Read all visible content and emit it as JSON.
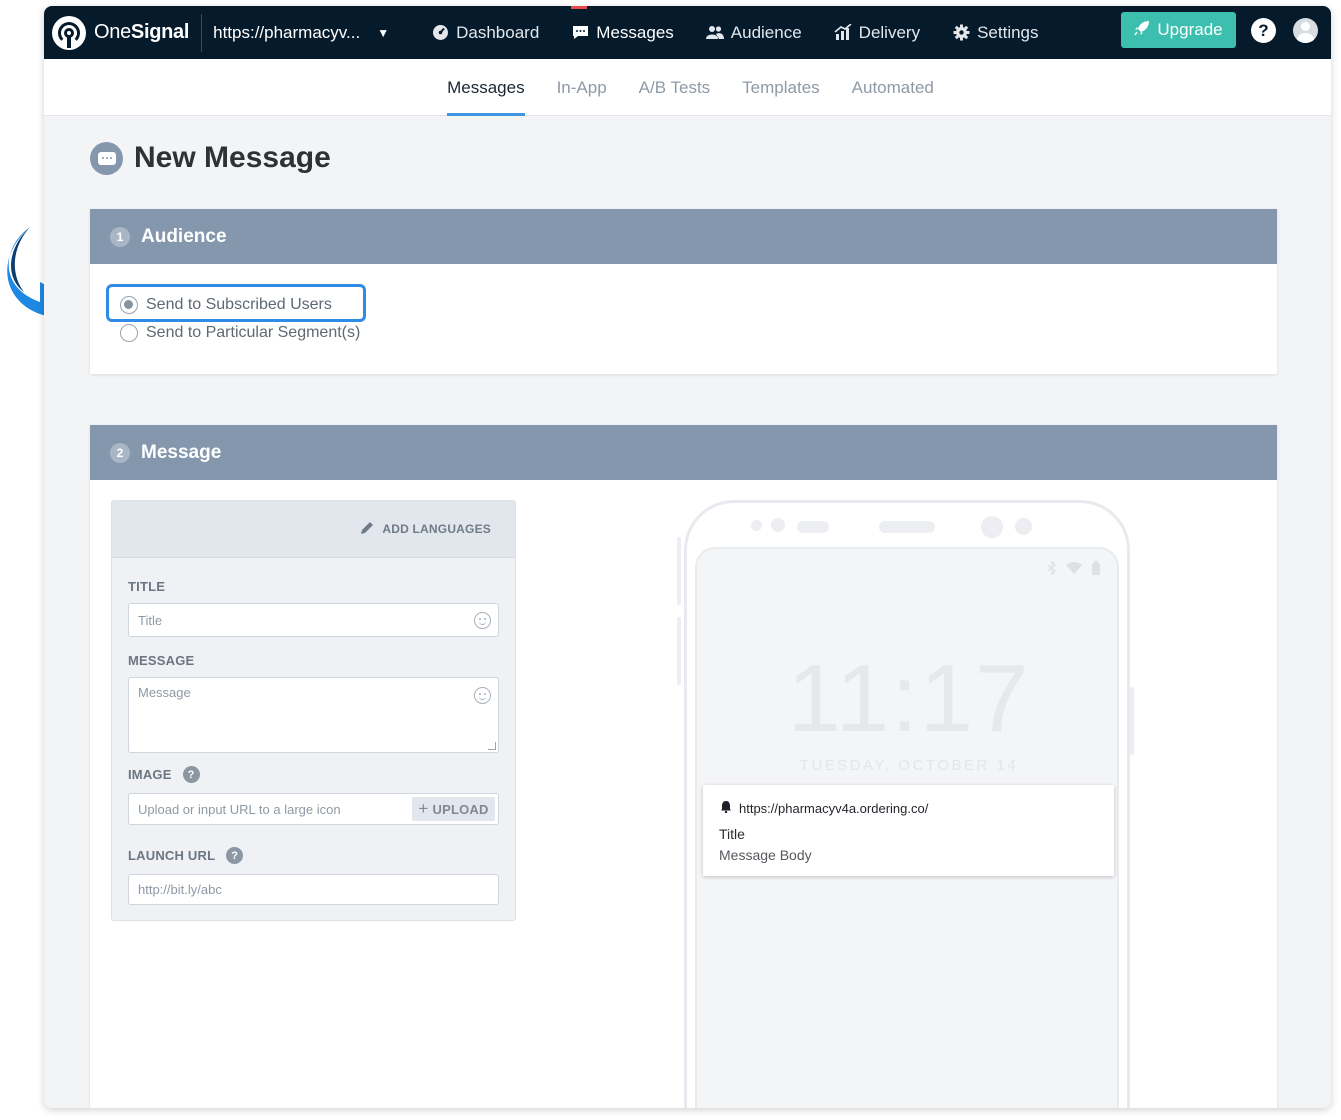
{
  "brand": {
    "name_part1": "One",
    "name_part2": "Signal"
  },
  "app_select": {
    "value": "https://pharmacyv...",
    "caret": "▼"
  },
  "topnav": {
    "items": [
      {
        "label": "Dashboard",
        "icon": "dashboard-icon"
      },
      {
        "label": "Messages",
        "icon": "messages-icon",
        "active": true
      },
      {
        "label": "Audience",
        "icon": "audience-icon"
      },
      {
        "label": "Delivery",
        "icon": "delivery-icon"
      },
      {
        "label": "Settings",
        "icon": "gear-icon"
      }
    ],
    "upgrade_label": "Upgrade",
    "help_label": "?"
  },
  "subnav": {
    "tabs": [
      {
        "label": "Messages",
        "active": true
      },
      {
        "label": "In-App"
      },
      {
        "label": "A/B Tests"
      },
      {
        "label": "Templates"
      },
      {
        "label": "Automated"
      }
    ]
  },
  "page": {
    "title": "New Message"
  },
  "audience": {
    "number": "1",
    "title": "Audience",
    "options": [
      {
        "label": "Send to Subscribed Users",
        "checked": true
      },
      {
        "label": "Send to Particular Segment(s)",
        "checked": false
      }
    ]
  },
  "message": {
    "number": "2",
    "title": "Message",
    "add_languages": "ADD LANGUAGES",
    "fields": {
      "title_label": "TITLE",
      "title_placeholder": "Title",
      "message_label": "MESSAGE",
      "message_placeholder": "Message",
      "image_label": "IMAGE",
      "image_placeholder": "Upload or input URL to a large icon",
      "upload_label": "UPLOAD",
      "launch_label": "LAUNCH URL",
      "launch_placeholder": "http://bit.ly/abc",
      "help": "?"
    },
    "preview": {
      "time": "11:17",
      "date": "TUESDAY, OCTOBER 14",
      "url": "https://pharmacyv4a.ordering.co/",
      "title": "Title",
      "body": "Message Body"
    }
  },
  "colors": {
    "nav_bg": "#051b2c",
    "section_header": "#8497ad",
    "accent_upgrade": "#3cbfae",
    "highlight": "#2e8be6",
    "active_tab": "#4096e0",
    "active_indicator": "#e54b4d"
  }
}
